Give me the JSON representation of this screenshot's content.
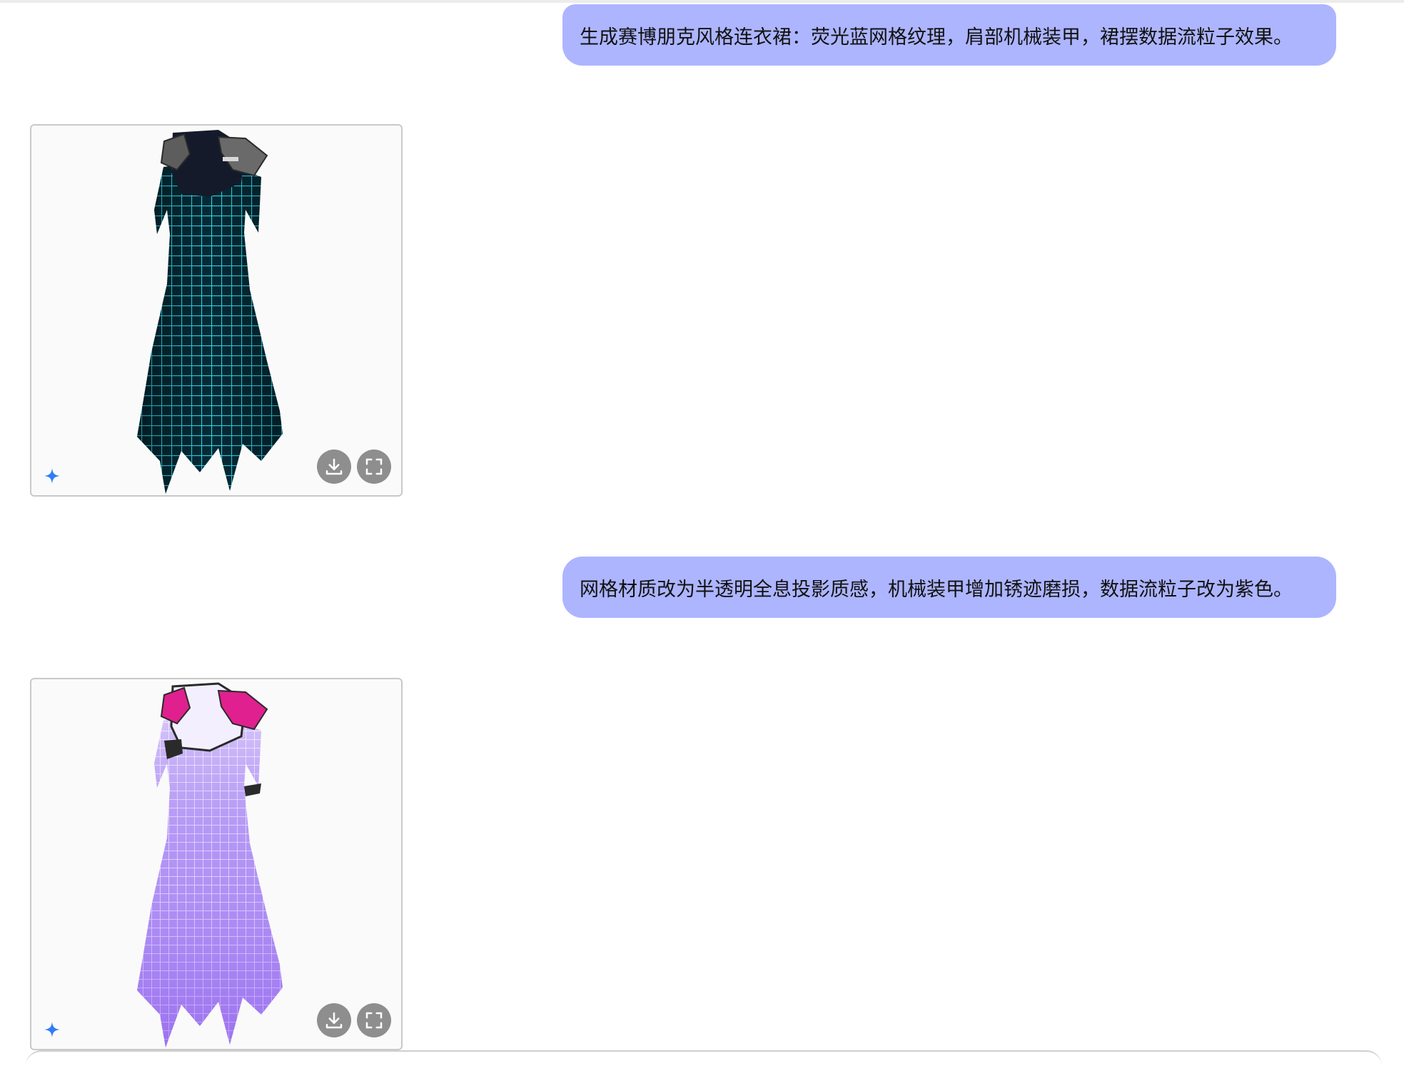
{
  "conversation": {
    "messages": [
      {
        "role": "user",
        "text": "生成赛博朋克风格连衣裙：荧光蓝网格纹理，肩部机械装甲，裙摆数据流粒子效果。"
      },
      {
        "role": "assistant",
        "image": {
          "description_icon": "dress-render",
          "icons": [
            "sparkle-icon",
            "download-icon",
            "fullscreen-icon"
          ]
        }
      },
      {
        "role": "user",
        "text": "网格材质改为半透明全息投影质感，机械装甲增加锈迹磨损，数据流粒子改为紫色。"
      },
      {
        "role": "assistant",
        "image": {
          "description_icon": "dress-render",
          "icons": [
            "sparkle-icon",
            "download-icon",
            "fullscreen-icon"
          ]
        }
      }
    ]
  },
  "colors": {
    "user_bubble": "#adb5ff",
    "card_button": "#8e8e8e",
    "sparkle": "#2f7cf6",
    "dress_blue": "#1fb6c9",
    "dress_purple": "#9b5cf0",
    "armor_pink": "#e0208f"
  }
}
